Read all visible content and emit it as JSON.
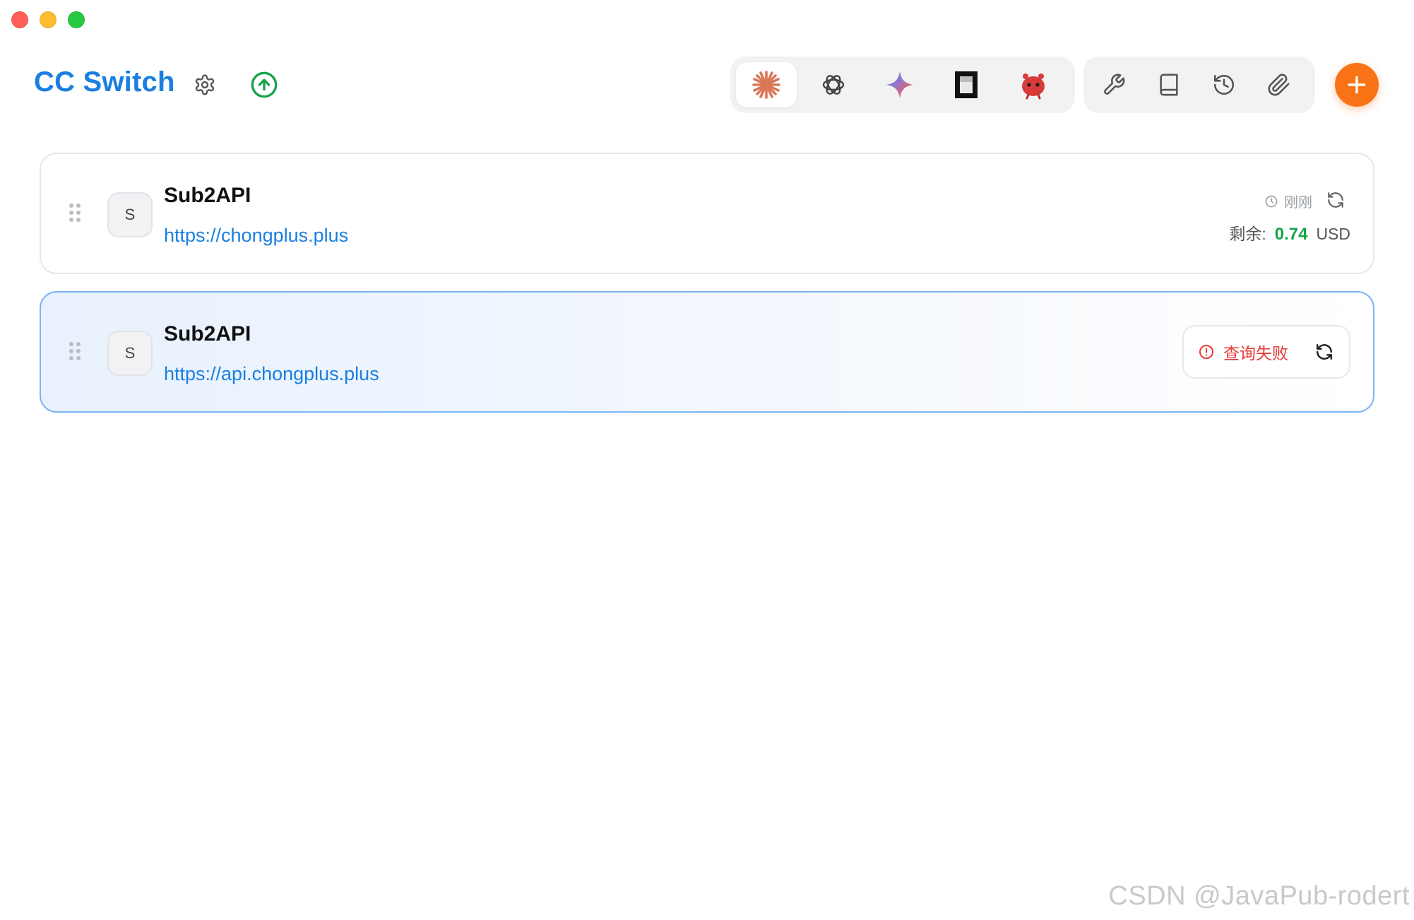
{
  "window": {
    "controls": [
      "close",
      "minimize",
      "maximize"
    ]
  },
  "header": {
    "title": "CC Switch",
    "title_color": "#1a7fe0",
    "icons": [
      "gear-icon",
      "upload-circle-icon"
    ],
    "app_tabs": [
      {
        "icon": "claude-icon",
        "active": true
      },
      {
        "icon": "openai-icon",
        "active": false
      },
      {
        "icon": "gemini-icon",
        "active": false
      },
      {
        "icon": "opencode-icon",
        "active": false
      },
      {
        "icon": "bot-mascot-icon",
        "active": false
      }
    ],
    "tool_buttons": [
      "wrench-icon",
      "book-icon",
      "history-icon",
      "paperclip-icon"
    ],
    "add_button_color": "#f97316"
  },
  "providers": [
    {
      "avatar": "S",
      "name": "Sub2API",
      "url": "https://chongplus.plus",
      "last_query": "刚刚",
      "balance_label": "剩余:",
      "balance_value": "0.74",
      "balance_unit": "USD",
      "status_color": "#16a34a"
    },
    {
      "avatar": "S",
      "name": "Sub2API",
      "url": "https://api.chongplus.plus",
      "selected": true,
      "error_text": "查询失败",
      "error_color": "#e53935"
    }
  ],
  "watermark": "CSDN @JavaPub-rodert"
}
